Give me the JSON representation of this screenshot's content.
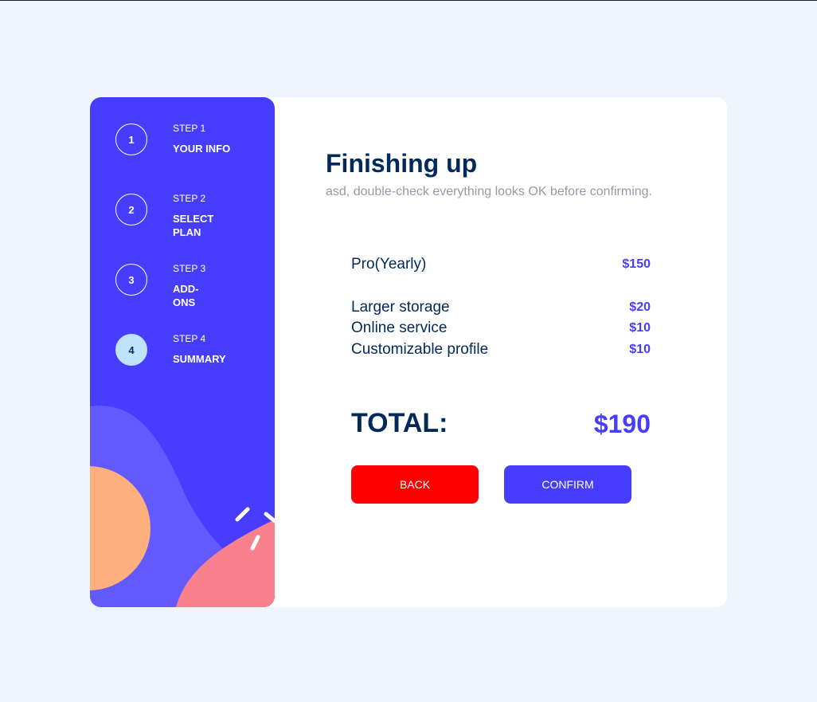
{
  "steps": [
    {
      "number": "1",
      "label": "STEP 1",
      "name": "YOUR INFO",
      "active": false
    },
    {
      "number": "2",
      "label": "STEP 2",
      "name": "SELECT PLAN",
      "active": false
    },
    {
      "number": "3",
      "label": "STEP 3",
      "name": "ADD-ONS",
      "active": false
    },
    {
      "number": "4",
      "label": "STEP 4",
      "name": "SUMMARY",
      "active": true
    }
  ],
  "summary": {
    "title": "Finishing up",
    "subtitle": "asd, double-check everything looks OK before confirming.",
    "plan": {
      "name": "Pro(Yearly)",
      "price": "$150"
    },
    "addons": [
      {
        "name": "Larger storage",
        "price": "$20"
      },
      {
        "name": "Online service",
        "price": "$10"
      },
      {
        "name": "Customizable profile",
        "price": "$10"
      }
    ],
    "total_label": "TOTAL:",
    "total_value": "$190"
  },
  "buttons": {
    "back": "BACK",
    "confirm": "CONFIRM"
  },
  "colors": {
    "page_background": "#eef5ff",
    "sidebar": "#473dff",
    "active_step": "#bfe2fd",
    "heading": "#02295a",
    "accent": "#473dff",
    "back_button": "#ff0000",
    "confirm_button": "#473dff"
  }
}
